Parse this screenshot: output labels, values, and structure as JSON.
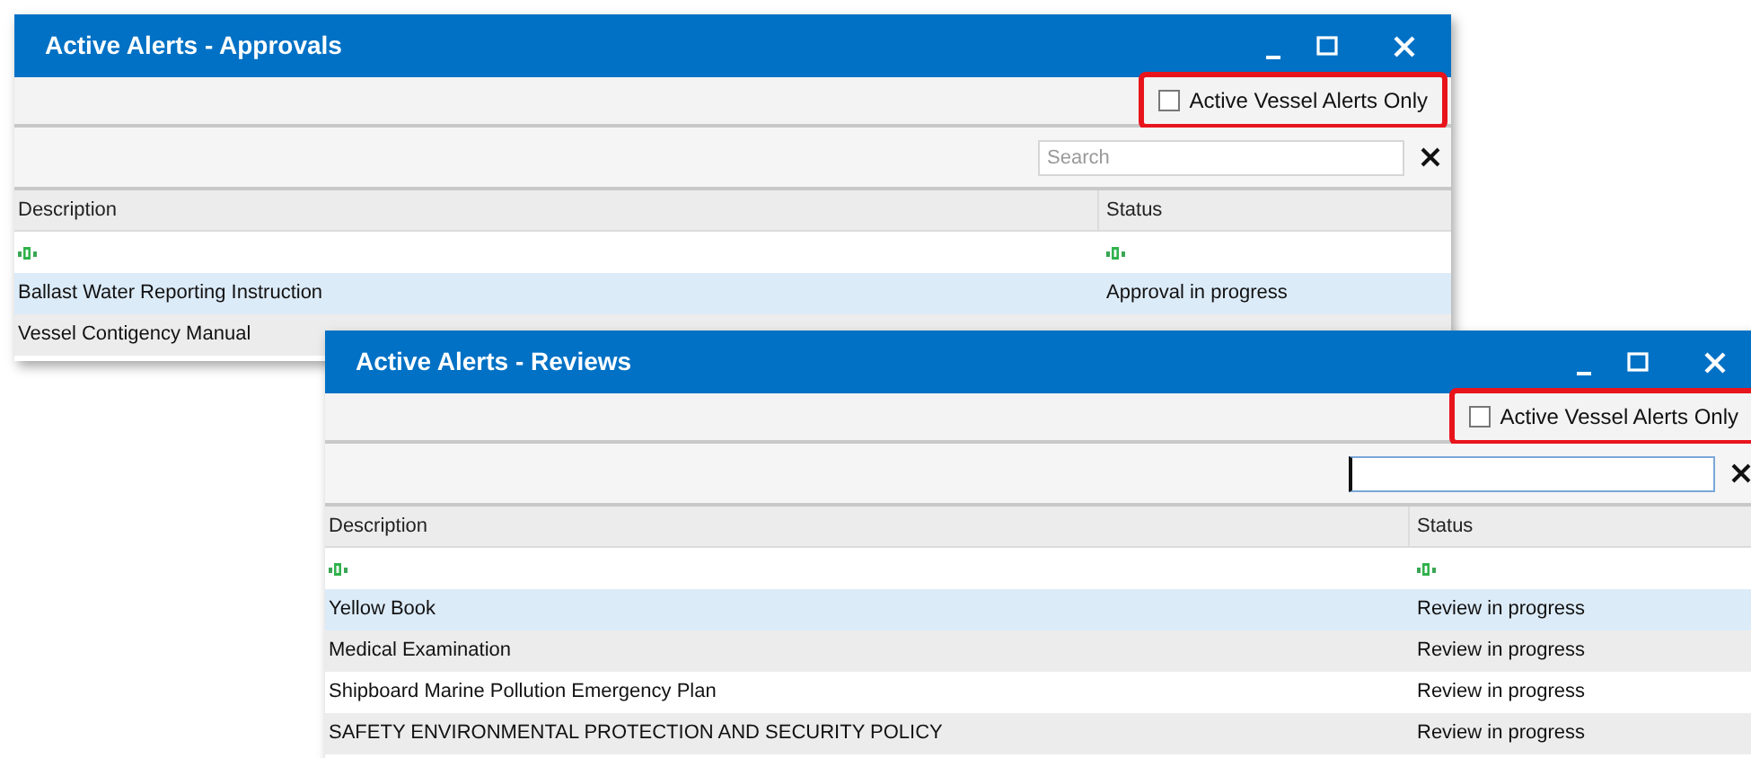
{
  "windows": [
    {
      "title": "Active Alerts - Approvals",
      "filter_toggle": {
        "label": "Active Vessel Alerts Only",
        "checked": false,
        "highlighted": true
      },
      "search": {
        "placeholder": "Search",
        "focused": false
      },
      "columns": [
        "Description",
        "Status"
      ],
      "rows": [
        {
          "description": "Ballast Water Reporting Instruction",
          "status": "Approval in progress",
          "selected": true
        },
        {
          "description": "Vessel Contigency Manual",
          "selected": false
        }
      ]
    },
    {
      "title": "Active Alerts - Reviews",
      "filter_toggle": {
        "label": "Active Vessel Alerts Only",
        "checked": false,
        "highlighted": true
      },
      "search": {
        "focused": true
      },
      "columns": [
        "Description",
        "Status"
      ],
      "rows": [
        {
          "description": "Yellow Book",
          "status": "Review in progress",
          "selected": true
        },
        {
          "description": "Medical Examination",
          "status": "Review in progress",
          "selected": false
        },
        {
          "description": "Shipboard Marine Pollution Emergency Plan",
          "status": "Review in progress",
          "selected": false
        },
        {
          "description": "SAFETY ENVIRONMENTAL PROTECTION AND SECURITY POLICY",
          "status": "Review in progress",
          "selected": false
        }
      ]
    }
  ]
}
